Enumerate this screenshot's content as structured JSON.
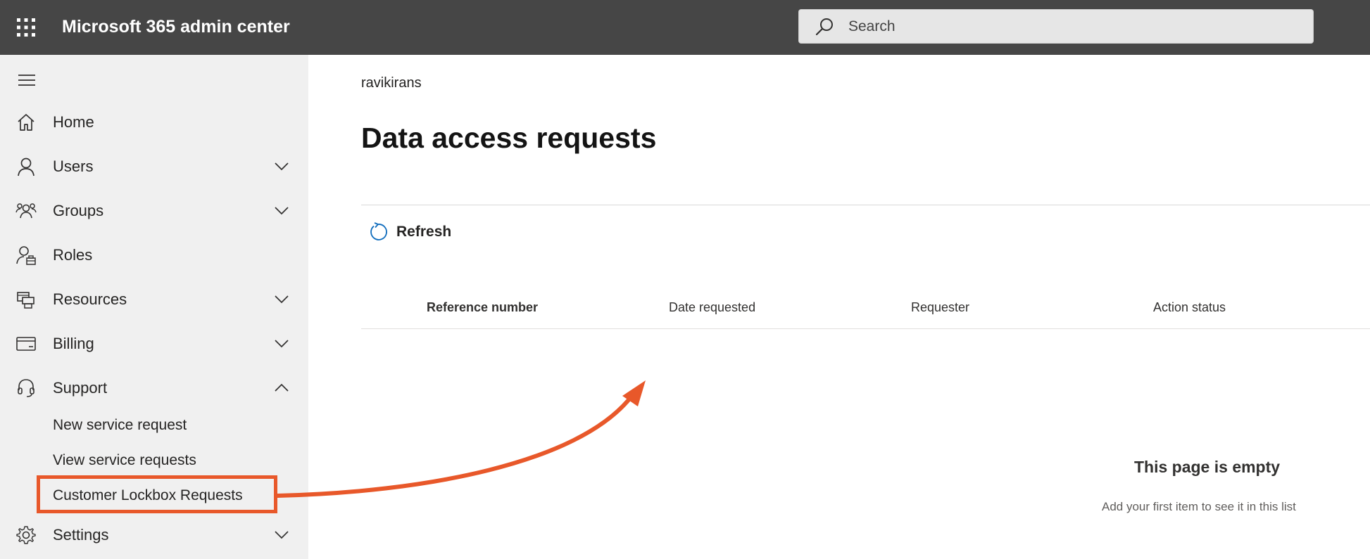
{
  "header": {
    "app_title": "Microsoft 365 admin center",
    "search_placeholder": "Search",
    "background_color": "#464646"
  },
  "sidebar": {
    "background_color": "#f0f0f0",
    "items": [
      {
        "label": "Home",
        "icon": "home-icon",
        "expandable": false
      },
      {
        "label": "Users",
        "icon": "user-icon",
        "expandable": true,
        "expanded": false
      },
      {
        "label": "Groups",
        "icon": "groups-icon",
        "expandable": true,
        "expanded": false
      },
      {
        "label": "Roles",
        "icon": "roles-icon",
        "expandable": false
      },
      {
        "label": "Resources",
        "icon": "resources-icon",
        "expandable": true,
        "expanded": false
      },
      {
        "label": "Billing",
        "icon": "billing-icon",
        "expandable": true,
        "expanded": false
      },
      {
        "label": "Support",
        "icon": "headset-icon",
        "expandable": true,
        "expanded": true
      },
      {
        "label": "Settings",
        "icon": "gear-icon",
        "expandable": true,
        "expanded": false
      }
    ],
    "support_subitems": [
      {
        "label": "New service request"
      },
      {
        "label": "View service requests"
      },
      {
        "label": "Customer Lockbox Requests",
        "highlighted": true
      }
    ]
  },
  "main": {
    "tenant_name": "ravikirans",
    "page_title": "Data access requests",
    "refresh_label": "Refresh",
    "columns": [
      "Reference number",
      "Date requested",
      "Requester",
      "Action status"
    ],
    "empty_state": {
      "title": "This page is empty",
      "subtitle": "Add your first item to see it in this list"
    }
  },
  "annotation": {
    "color": "#e8582a"
  }
}
